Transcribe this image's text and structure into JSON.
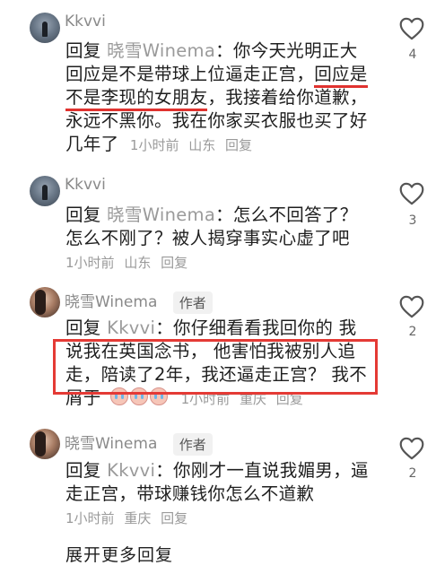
{
  "comments": [
    {
      "username": "Kkvvi",
      "prefix": "回复",
      "mention": "晓雪Winema",
      "text_a": "：你今天光明正大回应是不是带球上位逼走正宫，",
      "text_underlined": "回应是不是李现的女朋友",
      "text_b": "，我接着给你道歉，永远不黑你。我在你家买衣服也买了好几年了",
      "time": "1小时前",
      "location": "山东",
      "reply": "回复",
      "likes": "4"
    },
    {
      "username": "Kkvvi",
      "prefix": "回复",
      "mention": "晓雪Winema",
      "text": "：怎么不回答了？怎么不刚了？被人揭穿事实心虚了吧",
      "time": "1小时前",
      "location": "山东",
      "reply": "回复",
      "likes": "3"
    },
    {
      "username": "晓雪Winema",
      "author_tag": "作者",
      "prefix": "回复",
      "mention": "Kkvvi",
      "text": "：你仔细看看我回你的 我说我在英国念书， 他害怕我被别人追走，陪读了2年，我还逼走正宫？ 我不屑于",
      "time": "1小时前",
      "location": "重庆",
      "reply": "回复",
      "likes": "2"
    },
    {
      "username": "晓雪Winema",
      "author_tag": "作者",
      "prefix": "回复",
      "mention": "Kkvvi",
      "text": "：你刚才一直说我媚男，逼走正宫，带球赚钱你怎么不道歉",
      "time": "1小时前",
      "location": "重庆",
      "reply": "回复",
      "likes": "2"
    }
  ],
  "expand_more": "展开更多回复",
  "icons": {
    "like": "heart-outline-icon",
    "emoji": "crying-face-emoji"
  },
  "colors": {
    "highlight": "#e43a35",
    "muted": "#9a9a9a"
  }
}
